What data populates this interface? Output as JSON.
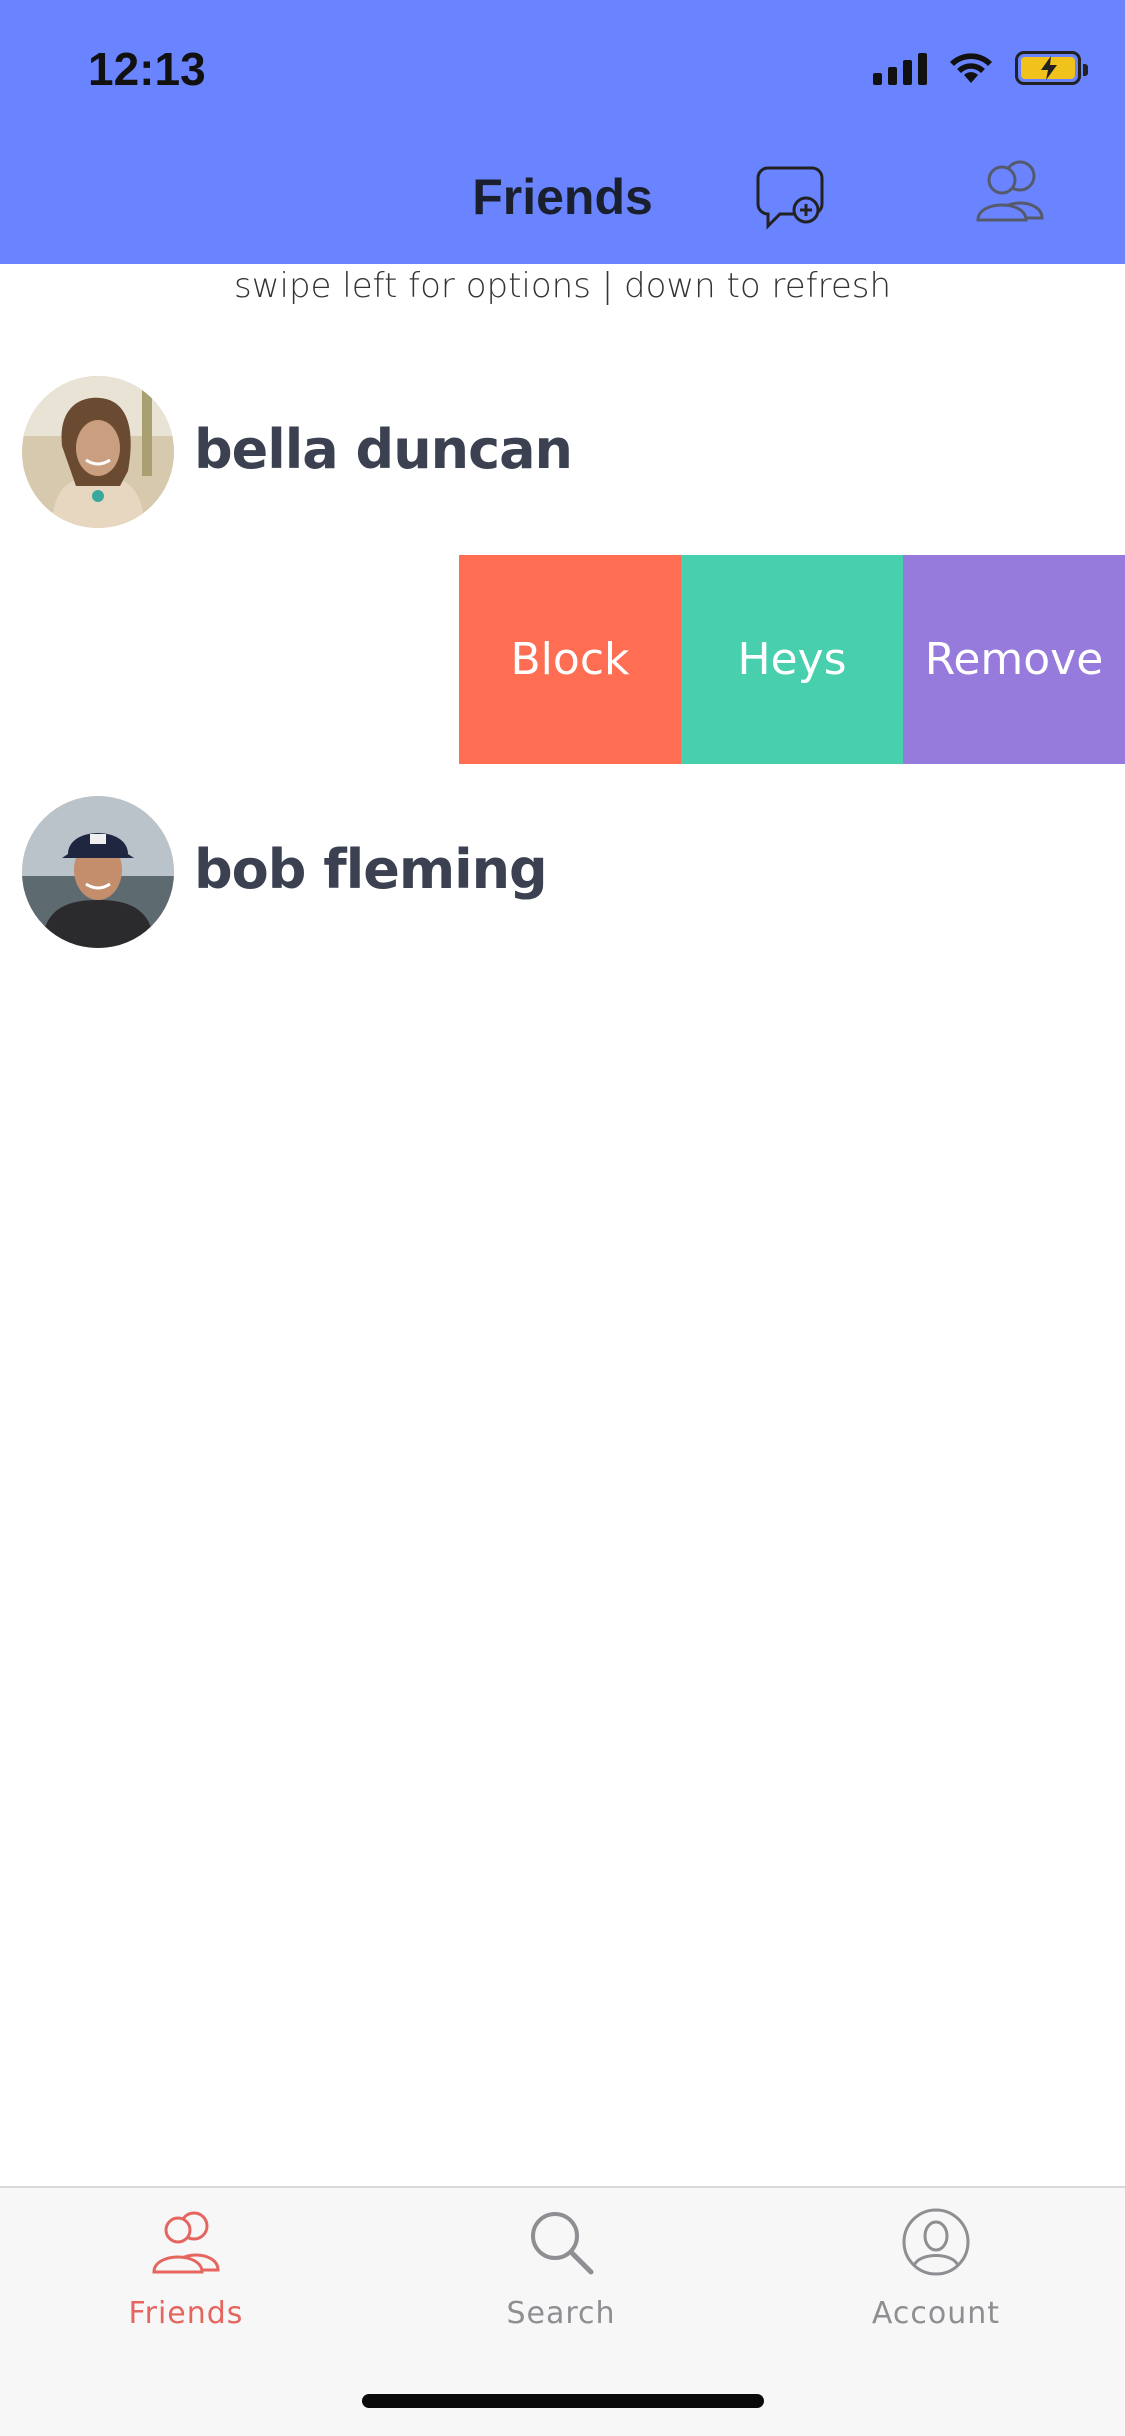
{
  "status_bar": {
    "time": "12:13"
  },
  "header": {
    "title": "Friends"
  },
  "hint": "swipe left for options | down to refresh",
  "friends": [
    {
      "name": "bella duncan"
    },
    {
      "name": "bob fleming"
    }
  ],
  "swipe_actions": [
    {
      "label": "Block",
      "color": "#ff6e52"
    },
    {
      "label": "Heys",
      "color": "#48cfae"
    },
    {
      "label": "Remove",
      "color": "#967adc"
    }
  ],
  "tabbar": {
    "tabs": [
      {
        "label": "Friends",
        "icon": "friends-icon",
        "active": true,
        "color": "#e4665f"
      },
      {
        "label": "Search",
        "icon": "search-icon",
        "active": false,
        "color": "#8e8e93"
      },
      {
        "label": "Account",
        "icon": "account-icon",
        "active": false,
        "color": "#8e8e93"
      }
    ]
  },
  "colors": {
    "header_bg": "#6a84ff",
    "name_text": "#3b4150"
  }
}
